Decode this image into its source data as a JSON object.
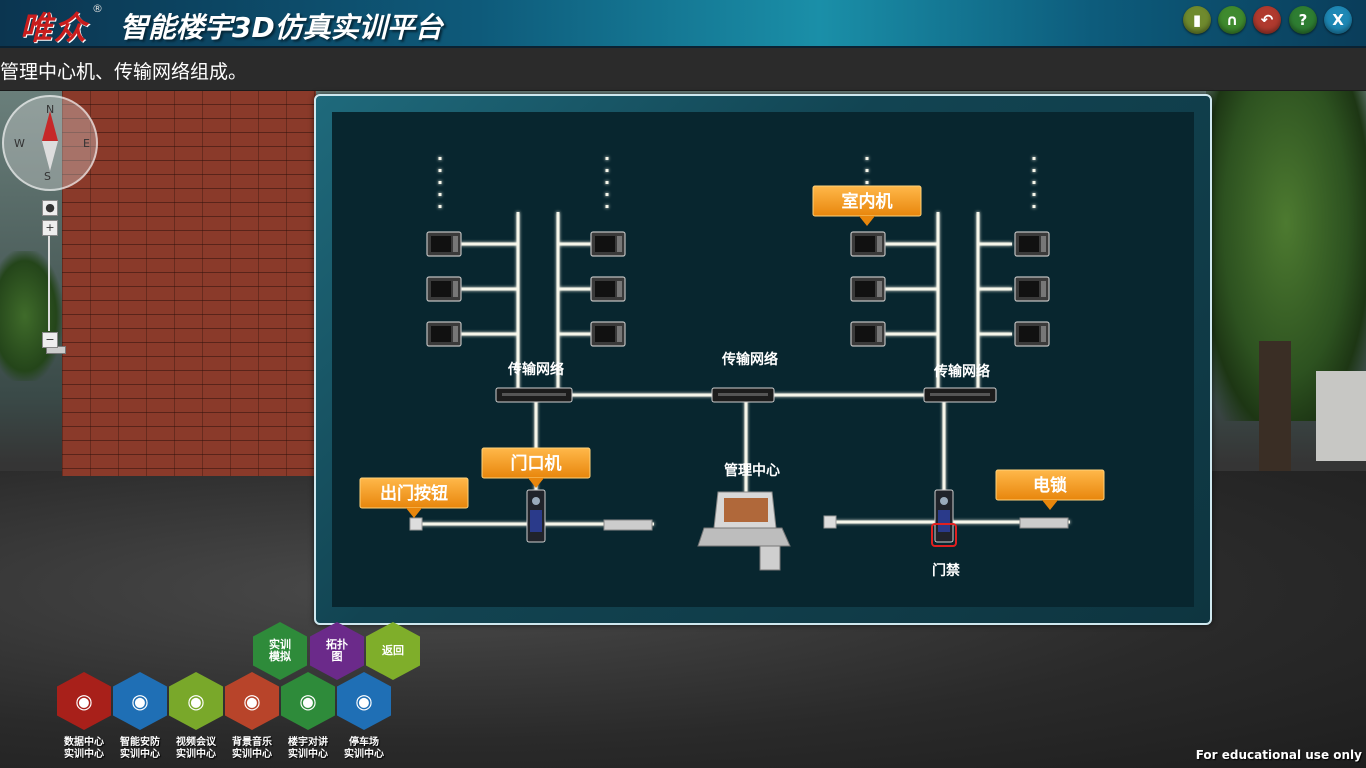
{
  "app": {
    "logo_text": "唯众",
    "logo_reg": "®",
    "title": "智能楼宇3D仿真实训平台"
  },
  "toolbar": {
    "buttons": [
      {
        "name": "speaker",
        "glyph": "▮",
        "color": "#6f8a2e"
      },
      {
        "name": "headphones",
        "glyph": "∩",
        "color": "#3f8a2e"
      },
      {
        "name": "back",
        "glyph": "↶",
        "color": "#b03a2e"
      },
      {
        "name": "help",
        "glyph": "?",
        "color": "#2e7d32"
      },
      {
        "name": "close",
        "glyph": "X",
        "color": "#1e88b5"
      }
    ]
  },
  "subtitle": "管理中心机、传输网络组成。",
  "compass": {
    "n": "N",
    "e": "E",
    "s": "S",
    "w": "W"
  },
  "zoom": {
    "plus": "+",
    "minus": "−"
  },
  "diagram": {
    "labels": {
      "network_left": "传输网络",
      "network_mid": "传输网络",
      "network_right": "传输网络",
      "mgmt_center": "管理中心",
      "access_control": "门禁"
    },
    "callouts": {
      "indoor_unit": "室内机",
      "door_unit": "门口机",
      "exit_button": "出门按钮",
      "electric_lock": "电锁"
    },
    "colors": {
      "callout": "#f39a1a",
      "wire": "#f6f6ea",
      "highlight": "#e02020"
    }
  },
  "menu": {
    "top": [
      {
        "label": "实训\n模拟",
        "color": "#2e8b3a"
      },
      {
        "label": "拓扑\n图",
        "color": "#6b2a8a"
      },
      {
        "label": "返回",
        "color": "#7fae2a"
      }
    ],
    "bottom": [
      {
        "label": "数据中心\n实训中心",
        "color": "#a8201a"
      },
      {
        "label": "智能安防\n实训中心",
        "color": "#1f6fb5"
      },
      {
        "label": "视频会议\n实训中心",
        "color": "#79a82a"
      },
      {
        "label": "背景音乐\n实训中心",
        "color": "#b8442a"
      },
      {
        "label": "楼宇对讲\n实训中心",
        "color": "#2e8b3a"
      },
      {
        "label": "停车场\n实训中心",
        "color": "#1f6fb5"
      }
    ]
  },
  "watermark": "For educational use only"
}
